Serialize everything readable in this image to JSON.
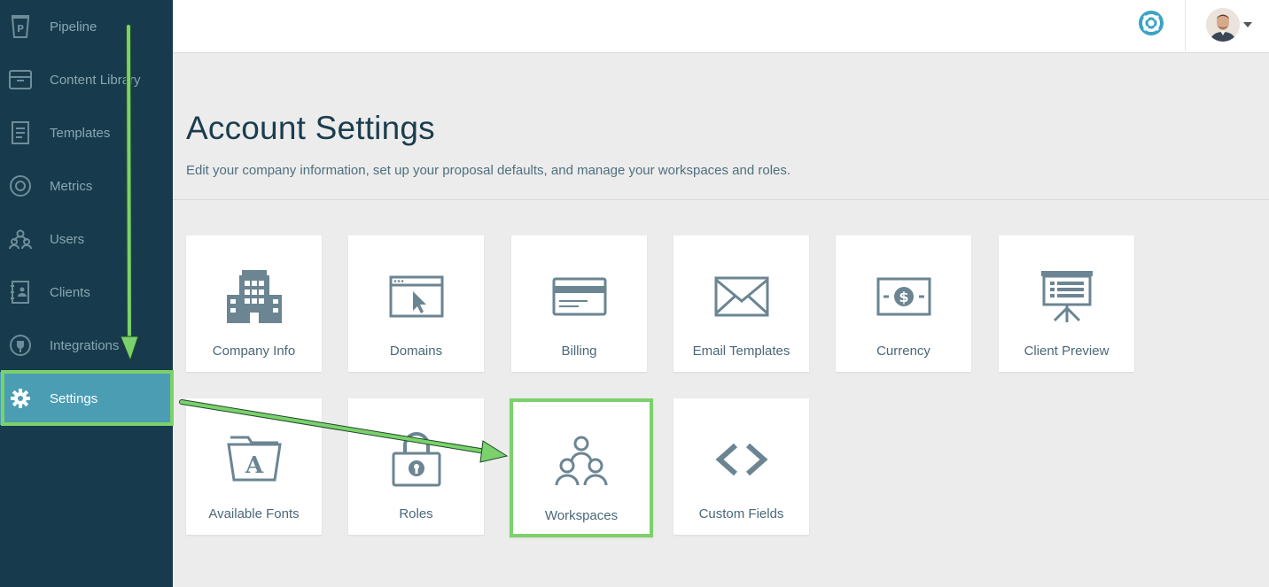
{
  "sidebar": {
    "items": [
      {
        "label": "Pipeline",
        "icon": "pipeline-icon"
      },
      {
        "label": "Content Library",
        "icon": "archive-box-icon"
      },
      {
        "label": "Templates",
        "icon": "templates-icon"
      },
      {
        "label": "Metrics",
        "icon": "metrics-icon"
      },
      {
        "label": "Users",
        "icon": "users-icon"
      },
      {
        "label": "Clients",
        "icon": "clients-icon"
      },
      {
        "label": "Integrations",
        "icon": "plug-icon"
      },
      {
        "label": "Settings",
        "icon": "gear-icon",
        "active": true
      }
    ]
  },
  "header": {
    "help_icon": "lifebuoy-icon",
    "avatar": "user-avatar"
  },
  "page": {
    "title": "Account Settings",
    "subtitle": "Edit your company information, set up your proposal defaults, and manage your workspaces and roles."
  },
  "tiles": [
    {
      "label": "Company Info",
      "icon": "building-icon"
    },
    {
      "label": "Domains",
      "icon": "browser-cursor-icon"
    },
    {
      "label": "Billing",
      "icon": "credit-card-icon"
    },
    {
      "label": "Email Templates",
      "icon": "envelope-icon"
    },
    {
      "label": "Currency",
      "icon": "dollar-bill-icon"
    },
    {
      "label": "Client Preview",
      "icon": "presentation-board-icon"
    },
    {
      "label": "Available Fonts",
      "icon": "font-folder-icon"
    },
    {
      "label": "Roles",
      "icon": "padlock-icon"
    },
    {
      "label": "Workspaces",
      "icon": "group-users-icon",
      "highlighted": true
    },
    {
      "label": "Custom Fields",
      "icon": "code-brackets-icon"
    }
  ],
  "colors": {
    "sidebar_bg": "#173b4c",
    "active_bg": "#4a9db3",
    "highlight": "#7bd16b",
    "icon": "#6b8592",
    "help": "#3aa3c4"
  }
}
